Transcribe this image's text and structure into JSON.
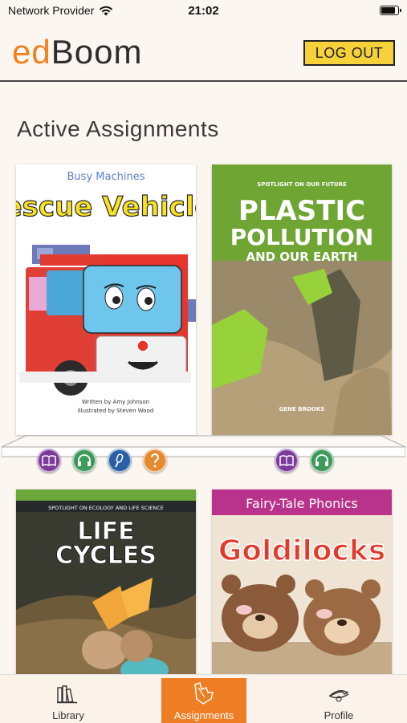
{
  "status_bar": {
    "carrier": "Network Provider",
    "time": "21:02"
  },
  "header": {
    "logo_ed": "ed",
    "logo_boom": "Boom",
    "logout_label": "LOG OUT"
  },
  "section_title": "Active Assignments",
  "books": [
    {
      "series": "Busy Machines",
      "title": "Rescue Vehicles",
      "credits": [
        "Written by Amy Johnson",
        "Illustrated by Steven Wood"
      ]
    },
    {
      "series": "SPOTLIGHT ON OUR FUTURE",
      "title_line1": "PLASTIC",
      "title_line2": "POLLUTION",
      "subtitle": "AND OUR EARTH",
      "author": "GENE BROOKS"
    },
    {
      "series": "SPOTLIGHT ON ECOLOGY AND LIFE SCIENCE",
      "title_line1": "LIFE",
      "title_line2": "CYCLES"
    },
    {
      "series": "Fairy-Tale Phonics",
      "title": "Goldilocks"
    }
  ],
  "icons": {
    "book1_actions": [
      "read-icon",
      "listen-icon",
      "record-icon",
      "quiz-icon"
    ],
    "book2_actions": [
      "read-icon",
      "listen-icon"
    ]
  },
  "tabs": {
    "library": "Library",
    "assignments": "Assignments",
    "profile": "Profile"
  },
  "colors": {
    "accent": "#ee7d24",
    "logout_bg": "#f6d13a",
    "background": "#fcf6f0"
  }
}
